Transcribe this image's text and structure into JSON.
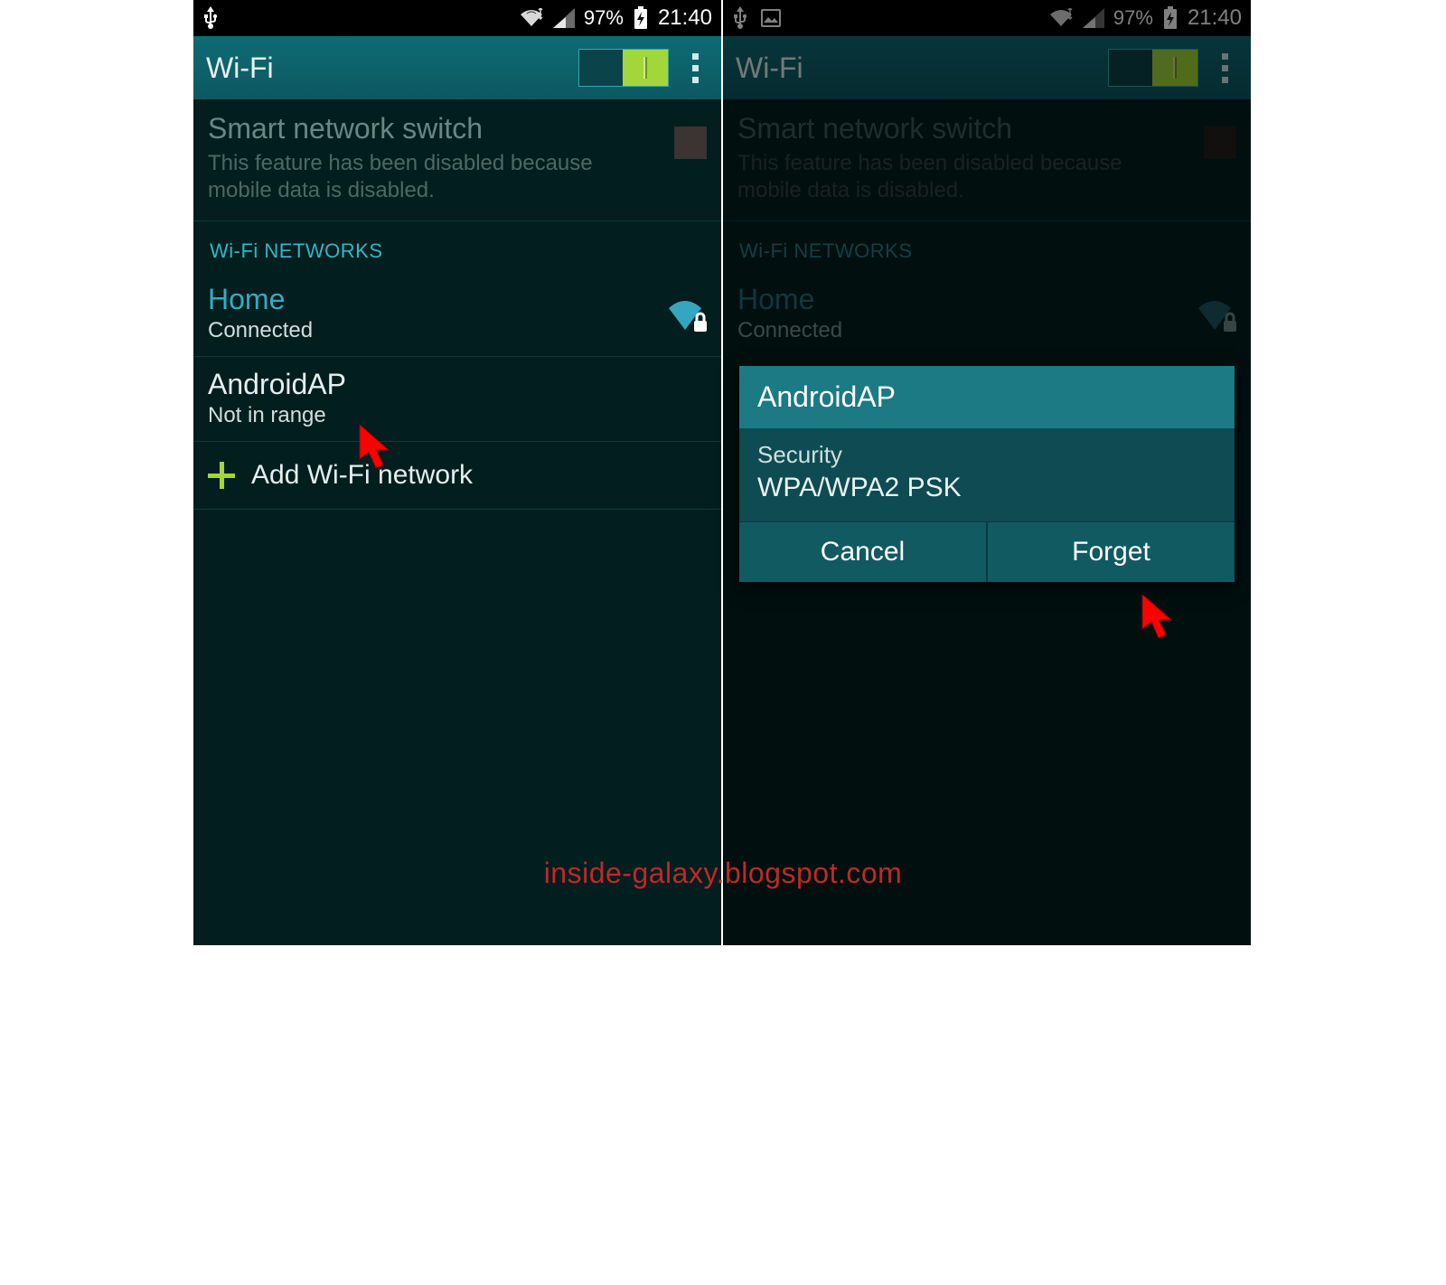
{
  "status": {
    "battery": "97%",
    "time": "21:40"
  },
  "header": {
    "title": "Wi-Fi"
  },
  "sns": {
    "title": "Smart network switch",
    "sub": "This feature has been disabled because mobile data is disabled."
  },
  "section_header": "Wi-Fi NETWORKS",
  "networks": {
    "home": {
      "name": "Home",
      "status": "Connected"
    },
    "ap": {
      "name": "AndroidAP",
      "status": "Not in range"
    }
  },
  "add_label": "Add Wi-Fi network",
  "dialog": {
    "title": "AndroidAP",
    "sec_label": "Security",
    "sec_value": "WPA/WPA2 PSK",
    "cancel": "Cancel",
    "forget": "Forget"
  },
  "watermark": "inside-galaxy.blogspot.com"
}
